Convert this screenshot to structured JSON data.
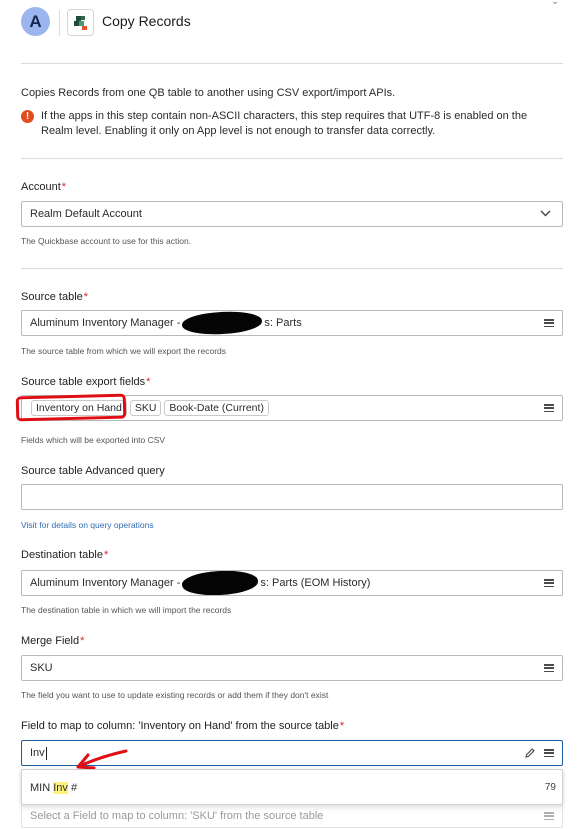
{
  "header": {
    "avatar_letter": "A",
    "title": "Copy Records"
  },
  "intro": {
    "description": "Copies Records from one QB table to another using CSV export/import APIs.",
    "warning": "If the apps in this step contain non-ASCII characters, this step requires that UTF-8 is enabled on the Realm level. Enabling it only on App level is not enough to transfer data correctly."
  },
  "account": {
    "label": "Account",
    "value": "Realm Default Account",
    "hint": "The Quickbase account to use for this action."
  },
  "source_table": {
    "label": "Source table",
    "value_start": "Aluminum Inventory Manager -",
    "value_end": "s: Parts",
    "hint": "The source table from which we will export the records"
  },
  "export_fields": {
    "label": "Source table export fields",
    "chips": [
      "Inventory on Hand",
      "SKU",
      "Book-Date (Current)"
    ],
    "hint": "Fields which will be exported into CSV"
  },
  "advanced_query": {
    "label": "Source table Advanced query",
    "value": "",
    "link": "Visit for details on query operations"
  },
  "destination_table": {
    "label": "Destination table",
    "value_start": "Aluminum Inventory Manager -",
    "value_end": "s: Parts (EOM History)",
    "hint": "The destination table in which we will import the records"
  },
  "merge_field": {
    "label": "Merge Field",
    "value": "SKU",
    "hint": "The field you want to use to update existing records or add them if they don't exist"
  },
  "map_inventory": {
    "label": "Field to map to column: 'Inventory on Hand' from the source table",
    "value": "Inv",
    "option": {
      "before": "MIN ",
      "match": "Inv",
      "after": " #",
      "id": "79"
    }
  },
  "map_sku": {
    "placeholder": "Select a Field to map to column: 'SKU' from the source table"
  },
  "colors": {
    "accent": "#1e5aa0",
    "required": "#d9232d",
    "warning": "#e14c21",
    "annotation": "#e00d14",
    "avatar": "#9bb5ef"
  }
}
